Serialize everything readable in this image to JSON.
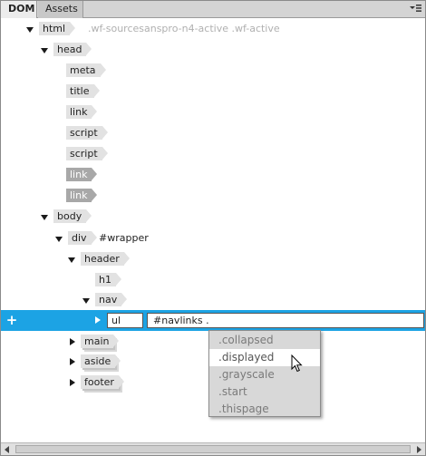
{
  "tabs": {
    "dom": "DOM",
    "assets": "Assets"
  },
  "icons": {
    "panel_menu": "panel-menu-icon",
    "add": "plus-icon",
    "cursor": "mouse-pointer-icon"
  },
  "colors": {
    "selection": "#1ca3e4",
    "tag_bg": "#e2e2e2",
    "tag_dim_bg": "#a8a8a8",
    "dropdown_bg": "#d8d8d8"
  },
  "tree": {
    "html": {
      "tag": "html",
      "classes": ".wf-sourcesanspro-n4-active .wf-active"
    },
    "head": {
      "tag": "head"
    },
    "head_children": [
      "meta",
      "title",
      "link",
      "script",
      "script",
      "link",
      "link"
    ],
    "body": {
      "tag": "body"
    },
    "div": {
      "tag": "div",
      "id": "#wrapper"
    },
    "header": {
      "tag": "header"
    },
    "h1": {
      "tag": "h1"
    },
    "nav": {
      "tag": "nav"
    },
    "main": {
      "tag": "main"
    },
    "aside": {
      "tag": "aside"
    },
    "footer": {
      "tag": "footer"
    }
  },
  "editor": {
    "tag_value": "ul",
    "attr_value": "#navlinks ."
  },
  "dropdown": {
    "items": [
      ".collapsed",
      ".displayed",
      ".grayscale",
      ".start",
      ".thispage"
    ],
    "hovered_index": 1
  }
}
